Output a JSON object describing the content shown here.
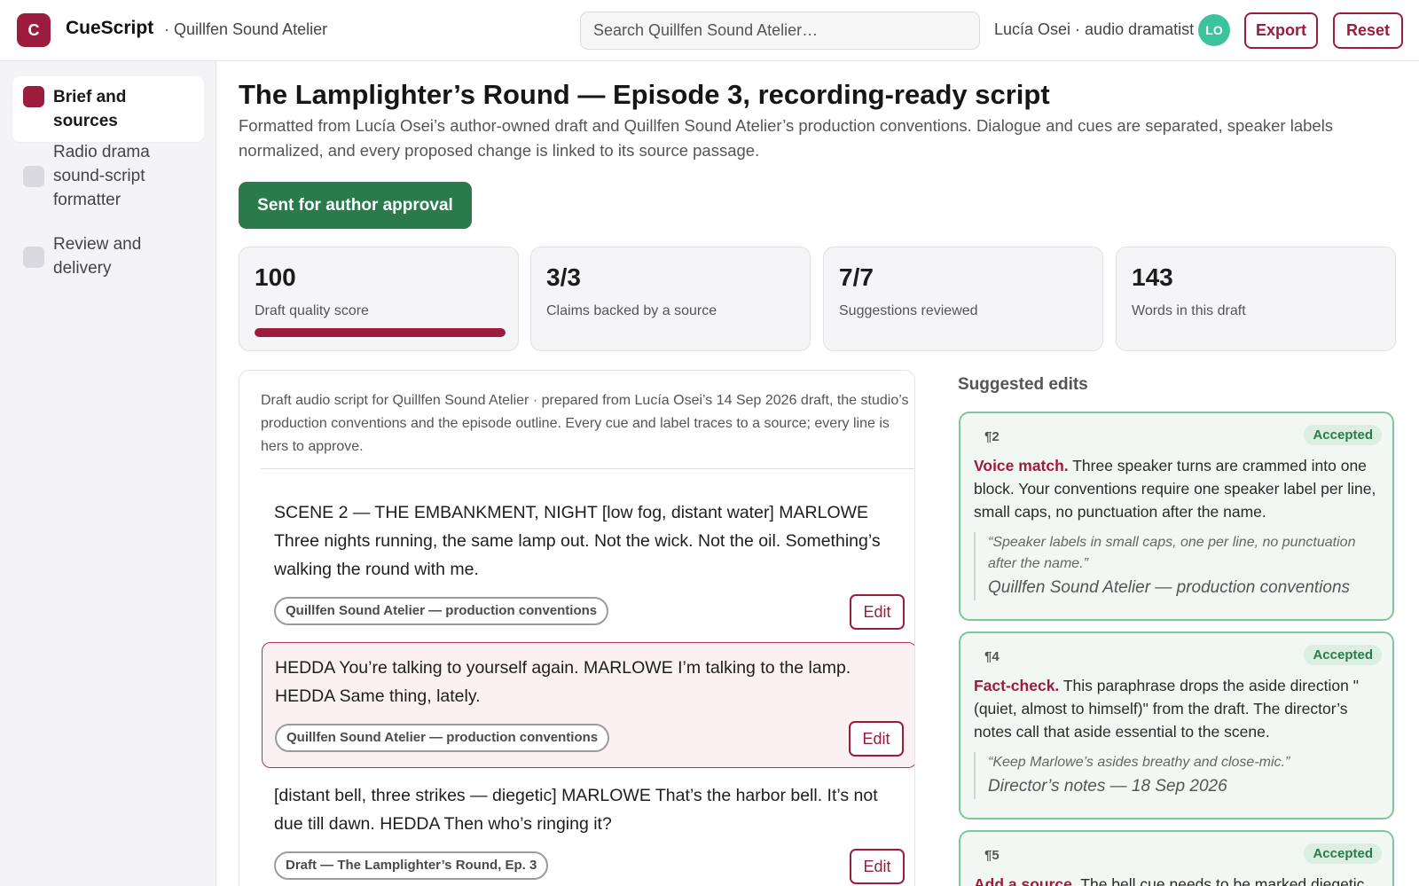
{
  "header": {
    "logo_letter": "C",
    "app_name": "CueScript",
    "workspace": "· Quillfen Sound Atelier",
    "search_placeholder": "Search Quillfen Sound Atelier…",
    "user": "Lucía Osei · audio dramatist",
    "avatar_initials": "LO",
    "export_label": "Export",
    "reset_label": "Reset"
  },
  "sidebar": {
    "items": [
      {
        "label": "Brief and sources",
        "active": true
      },
      {
        "label": "Radio drama sound-script formatter",
        "active": false
      },
      {
        "label": "Review and delivery",
        "active": false
      }
    ]
  },
  "main": {
    "title": "The Lamplighter’s Round — Episode 3, recording-ready script",
    "subtitle": "Formatted from Lucía Osei’s author-owned draft and Quillfen Sound Atelier’s production conventions. Dialogue and cues are separated, speaker labels normalized, and every proposed change is linked to its source passage.",
    "status_button": "Sent for author approval",
    "stats": [
      {
        "value": "100",
        "label": "Draft quality score",
        "progress": 1.0
      },
      {
        "value": "3/3",
        "label": "Claims backed by a source"
      },
      {
        "value": "7/7",
        "label": "Suggestions reviewed"
      },
      {
        "value": "143",
        "label": "Words in this draft"
      }
    ]
  },
  "script": {
    "intro": "Draft audio script for Quillfen Sound Atelier · prepared from Lucía Osei’s 14 Sep 2026 draft, the studio’s production conventions and the episode outline. Every cue and label traces to a source; every line is hers to approve.",
    "paragraphs": [
      {
        "text": "SCENE 2 — THE EMBANKMENT, NIGHT [low fog, distant water] MARLOWE Three nights running, the same lamp out. Not the wick. Not the oil. Something’s walking the round with me.",
        "source": "Quillfen Sound Atelier — production conventions",
        "edit_label": "Edit"
      },
      {
        "text": "HEDDA You’re talking to yourself again. MARLOWE I’m talking to the lamp. HEDDA Same thing, lately.",
        "source": "Quillfen Sound Atelier — production conventions",
        "edit_label": "Edit"
      },
      {
        "text": "[distant bell, three strikes — diegetic] MARLOWE That’s the harbor bell. It’s not due till dawn. HEDDA Then who’s ringing it?",
        "source": "Draft — The Lamplighter’s Round, Ep. 3",
        "edit_label": "Edit"
      }
    ]
  },
  "suggestions": {
    "heading": "Suggested edits",
    "items": [
      {
        "para": "¶2",
        "status": "Accepted",
        "kind": "Voice match.",
        "body": " Three speaker turns are crammed into one block. Your conventions require one speaker label per line, small caps, no punctuation after the name.",
        "quote": "“Speaker labels in small caps, one per line, no punctuation after the name.”",
        "quote_source": "Quillfen Sound Atelier — production conventions"
      },
      {
        "para": "¶4",
        "status": "Accepted",
        "kind": "Fact-check.",
        "body": " This paraphrase drops the aside direction \"(quiet, almost to himself)\" from the draft. The director’s notes call that aside essential to the scene.",
        "quote": "“Keep Marlowe’s asides breathy and close-mic.”",
        "quote_source": "Director’s notes — 18 Sep 2026"
      },
      {
        "para": "¶5",
        "status": "Accepted",
        "kind": "Add a source.",
        "body": " The bell cue needs to be marked diegetic",
        "quote": "",
        "quote_source": ""
      }
    ]
  },
  "colors": {
    "brand": "#9b1c3c",
    "success": "#2b7a4b",
    "avatar": "#3cc39b"
  }
}
